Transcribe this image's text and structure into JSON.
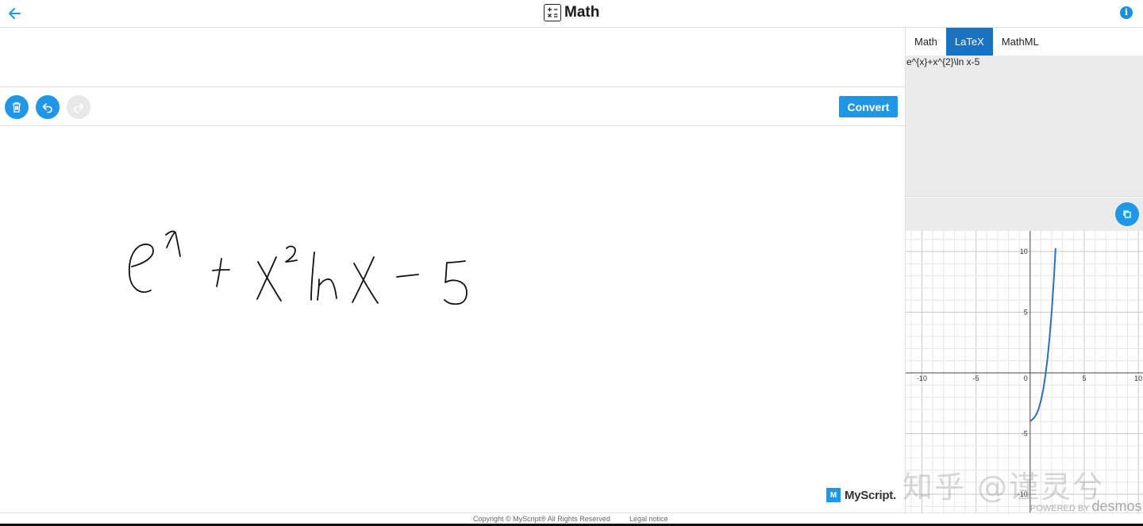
{
  "header": {
    "title": "Math",
    "info_glyph": "i"
  },
  "toolbar": {
    "convert_label": "Convert"
  },
  "output_panel": {
    "tabs": [
      {
        "label": "Math"
      },
      {
        "label": "LaTeX"
      },
      {
        "label": "MathML"
      }
    ],
    "active_tab": "LaTeX",
    "latex_output": "e^{x}+x^{2}\\ln x-5"
  },
  "branding": {
    "myscript_mark": "M",
    "myscript_label": "MyScript.",
    "powered_by": "POWERED BY",
    "desmos_label": "desmos",
    "watermark": "知乎 @谨灵兮"
  },
  "footer": {
    "copyright": "Copyright © MyScript® All Rights Reserved",
    "legal": "Legal notice"
  },
  "chart_data": {
    "type": "line",
    "function_latex": "e^{x}+x^{2}\\ln x-5",
    "xlim": [
      -11.5,
      10.5
    ],
    "ylim": [
      -11.5,
      11.7
    ],
    "x_ticks": [
      -10,
      -5,
      0,
      5,
      10
    ],
    "y_ticks": [
      -10,
      -5,
      5,
      10
    ],
    "grid": true,
    "series": [
      {
        "color": "#2d70b3",
        "x": [
          0.05,
          0.2,
          0.4,
          0.6,
          0.8,
          1.0,
          1.2,
          1.4,
          1.6,
          1.8,
          2.0,
          2.2,
          2.35
        ],
        "y": [
          -3.96,
          -3.84,
          -3.65,
          -3.36,
          -2.92,
          -2.28,
          -1.41,
          -0.28,
          1.16,
          2.95,
          5.16,
          7.84,
          10.27
        ]
      }
    ]
  },
  "colors": {
    "accent": "#1f97e6",
    "tab_active": "#1a73c1",
    "curve": "#2d70b3"
  }
}
